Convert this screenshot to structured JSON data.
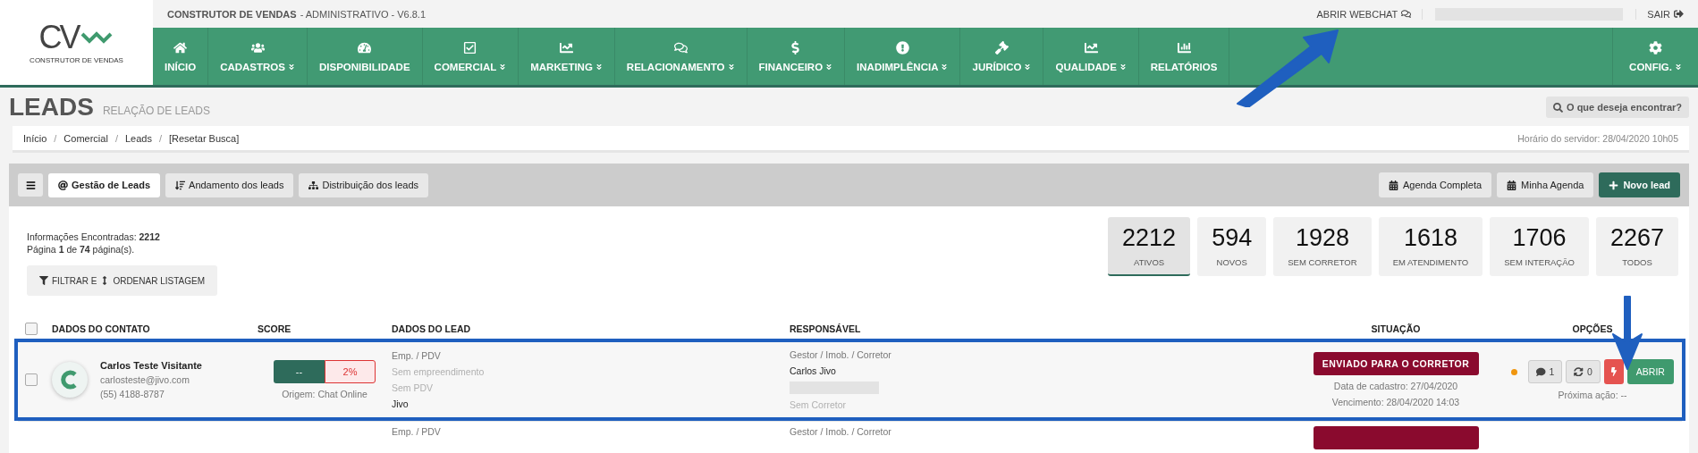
{
  "logo": {
    "mark": "CV",
    "caption": "CONSTRUTOR DE VENDAS"
  },
  "top_bar": {
    "app_name": "CONSTRUTOR DE VENDAS",
    "edition": "- ADMINISTRATIVO - V6.8.1",
    "webchat": "ABRIR WEBCHAT",
    "logout": "SAIR"
  },
  "nav": [
    {
      "label": "INÍCIO",
      "dropdown": false
    },
    {
      "label": "CADASTROS",
      "dropdown": true
    },
    {
      "label": "DISPONIBILIDADE",
      "dropdown": false
    },
    {
      "label": "COMERCIAL",
      "dropdown": true
    },
    {
      "label": "MARKETING",
      "dropdown": true
    },
    {
      "label": "RELACIONAMENTO",
      "dropdown": true
    },
    {
      "label": "FINANCEIRO",
      "dropdown": true
    },
    {
      "label": "INADIMPLÊNCIA",
      "dropdown": true
    },
    {
      "label": "JURÍDICO",
      "dropdown": true
    },
    {
      "label": "QUALIDADE",
      "dropdown": true
    },
    {
      "label": "RELATÓRIOS",
      "dropdown": false
    }
  ],
  "config": {
    "label": "CONFIG.",
    "dropdown": true
  },
  "page": {
    "title": "LEADS",
    "subtitle": "RELAÇÃO DE LEADS",
    "search": "O que deseja encontrar?"
  },
  "breadcrumb": {
    "items": [
      "Início",
      "Comercial",
      "Leads",
      "[Resetar Busca]"
    ],
    "separators": [
      "/",
      "/",
      "/"
    ],
    "server_time": "Horário do servidor: 28/04/2020 10h05"
  },
  "tabs": [
    {
      "label": "Gestão de Leads",
      "selected": true
    },
    {
      "label": "Andamento dos leads",
      "selected": false
    },
    {
      "label": "Distribuição dos leads",
      "selected": false
    }
  ],
  "actions": [
    {
      "label": "Agenda Completa",
      "kind": "plain"
    },
    {
      "label": "Minha Agenda",
      "kind": "plain"
    },
    {
      "label": "Novo lead",
      "kind": "primary"
    }
  ],
  "summary": {
    "found": "Informações Encontradas: **2212**",
    "pages": "Página **1** de **74** página(s).",
    "filter": "FILTRAR E",
    "order": "ORDENAR LISTAGEM"
  },
  "stats": [
    {
      "value": "2212",
      "label": "ATIVOS",
      "selected": true
    },
    {
      "value": "594",
      "label": "NOVOS",
      "selected": false
    },
    {
      "value": "1928",
      "label": "SEM CORRETOR",
      "selected": false
    },
    {
      "value": "1618",
      "label": "EM ATENDIMENTO",
      "selected": false
    },
    {
      "value": "1706",
      "label": "SEM INTERAÇÃO",
      "selected": false
    },
    {
      "value": "2267",
      "label": "TODOS",
      "selected": false
    }
  ],
  "select_all": {
    "checked": false
  },
  "columns": [
    "DADOS DO CONTATO",
    "SCORE",
    "DADOS DO LEAD",
    "RESPONSÁVEL",
    "SITUAÇÃO",
    "OPÇÕES"
  ],
  "rows": [
    {
      "highlighted": true,
      "checked": false,
      "name": "Carlos Teste Visitante",
      "email": "carlosteste@jivo.com",
      "phone": "(55) 4188-8787",
      "score": "--",
      "percent": "2%",
      "origin": "Origem: Chat Online",
      "lead": [
        {
          "text": "Emp. / PDV",
          "muted": false
        },
        {
          "text": "Sem empreendimento",
          "muted": true
        },
        {
          "text": "Sem PDV",
          "muted": true
        },
        {
          "text": "Jivo",
          "muted": false
        }
      ],
      "responsible": [
        {
          "text": "Gestor / Imob. / Corretor",
          "muted": false
        },
        {
          "text": "Carlos Jivo",
          "muted": false
        },
        {
          "text": "Sem Corretor",
          "muted": true
        }
      ],
      "status": "ENVIADO PARA O CORRETOR",
      "registered": "Data de cadastro: 27/04/2020",
      "due": "Vencimento: 28/04/2020 14:03",
      "color": "#f0960f",
      "comments": "1",
      "updates": "0",
      "open": "ABRIR",
      "next_action": "Próxima ação: --"
    },
    {
      "highlighted": false,
      "lead": [
        {
          "text": "Emp. / PDV",
          "muted": false
        }
      ],
      "responsible": [
        {
          "text": "Gestor / Imob. / Corretor",
          "muted": false
        }
      ]
    }
  ]
}
